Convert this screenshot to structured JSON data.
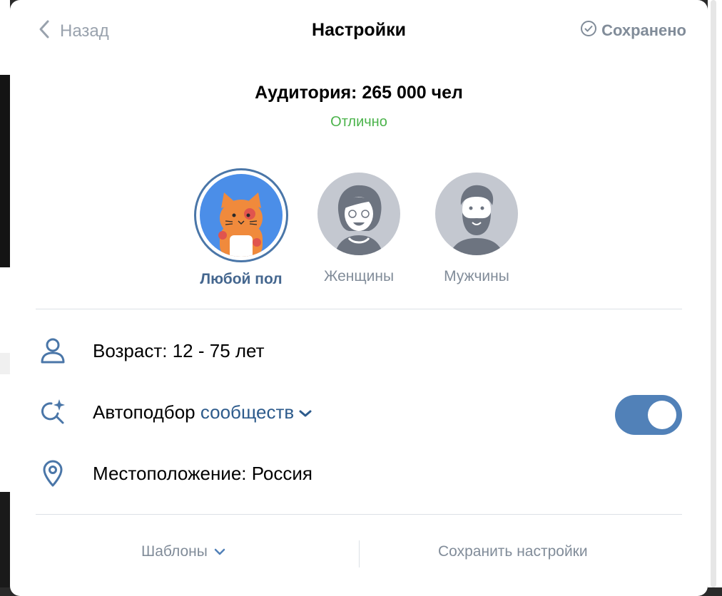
{
  "header": {
    "back_label": "Назад",
    "title": "Настройки",
    "saved_label": "Сохранено"
  },
  "audience": {
    "label": "Аудитория: 265 000 чел",
    "quality": "Отлично"
  },
  "gender_options": [
    {
      "label": "Любой пол",
      "selected": true,
      "icon": "cat-avatar-icon"
    },
    {
      "label": "Женщины",
      "selected": false,
      "icon": "woman-avatar-icon"
    },
    {
      "label": "Мужчины",
      "selected": false,
      "icon": "man-avatar-icon"
    }
  ],
  "settings": {
    "age_label": "Возраст: 12 - 75 лет",
    "auto_label": "Автоподбор",
    "auto_link": "сообществ",
    "auto_enabled": true,
    "location_label": "Местоположение: Россия"
  },
  "footer": {
    "templates_label": "Шаблоны",
    "save_label": "Сохранить настройки"
  },
  "colors": {
    "accent": "#5181b8",
    "success": "#4bb34b",
    "secondary_text": "#818c99"
  }
}
